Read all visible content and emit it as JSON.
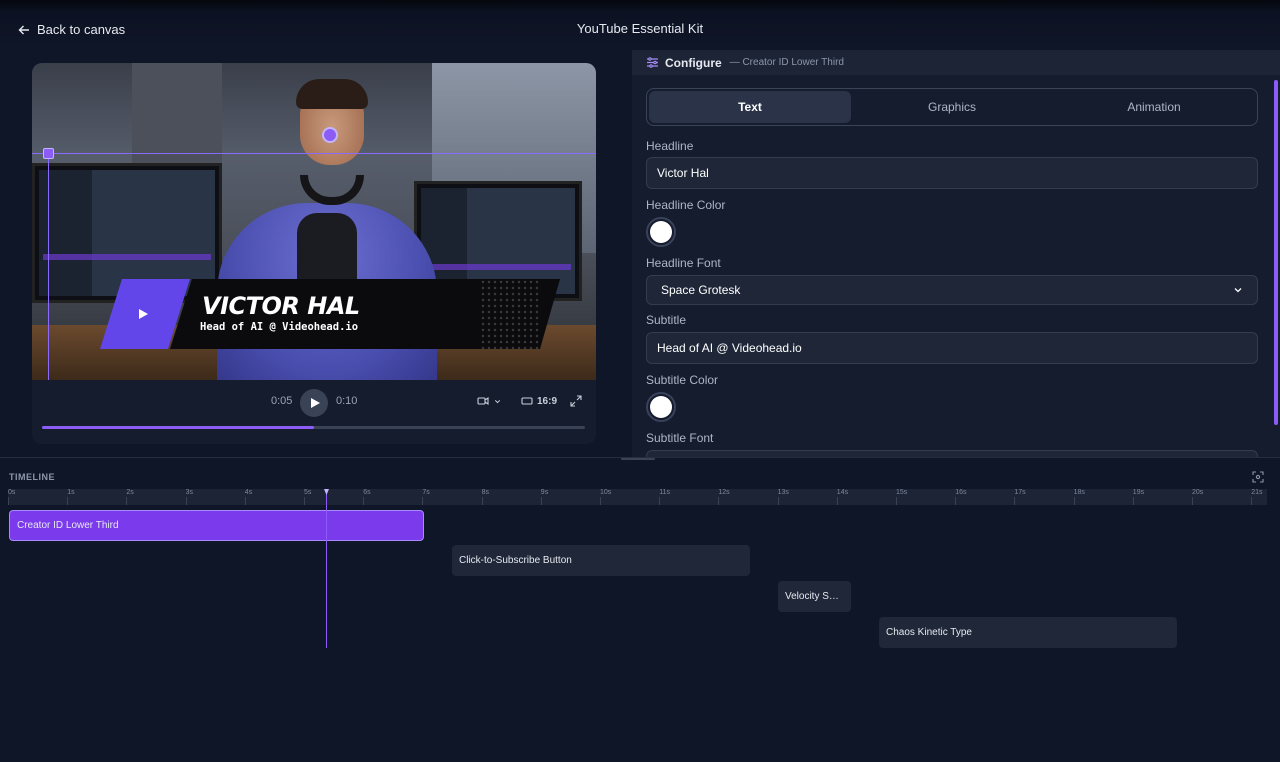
{
  "header": {
    "back_label": "Back to canvas",
    "title": "YouTube Essential Kit"
  },
  "preview": {
    "lower_third": {
      "name": "VICTOR HAL",
      "subtitle": "Head of AI @ Videohead.io"
    },
    "current_time": "0:05",
    "duration": "0:10",
    "aspect": "16:9",
    "progress": 0.5,
    "icons": [
      "play-icon",
      "camera-icon",
      "chevron-down-icon",
      "aspect-ratio-icon",
      "expand-icon"
    ]
  },
  "configure": {
    "title": "Configure",
    "subtitle": "— Creator ID Lower Third",
    "tabs": [
      {
        "label": "Text",
        "active": true
      },
      {
        "label": "Graphics",
        "active": false
      },
      {
        "label": "Animation",
        "active": false
      }
    ],
    "headline_label": "Headline",
    "headline_value": "Victor Hal",
    "headline_color_label": "Headline Color",
    "headline_color": "#ffffff",
    "headline_font_label": "Headline Font",
    "headline_font_value": "Space Grotesk",
    "subtitle_label": "Subtitle",
    "subtitle_value": "Head of AI @ Videohead.io",
    "subtitle_color_label": "Subtitle Color",
    "subtitle_color": "#ffffff",
    "subtitle_font_label": "Subtitle Font"
  },
  "timeline": {
    "label": "TIMELINE",
    "ticks": [
      "0s",
      "1s",
      "2s",
      "3s",
      "4s",
      "5s",
      "6s",
      "7s",
      "8s",
      "9s",
      "10s",
      "11s",
      "12s",
      "13s",
      "14s",
      "15s",
      "16s",
      "17s",
      "18s",
      "19s",
      "20s",
      "21s"
    ],
    "playhead_time": "5.4s",
    "clips": [
      {
        "label": "Creator ID Lower Third",
        "active": true
      },
      {
        "label": "Click-to-Subscribe Button",
        "active": false
      },
      {
        "label": "Velocity S…",
        "active": false
      },
      {
        "label": "Chaos Kinetic Type",
        "active": false
      }
    ]
  },
  "colors": {
    "accent": "#8b5cf6",
    "background": "#0f1628",
    "panel": "#141c2d"
  }
}
